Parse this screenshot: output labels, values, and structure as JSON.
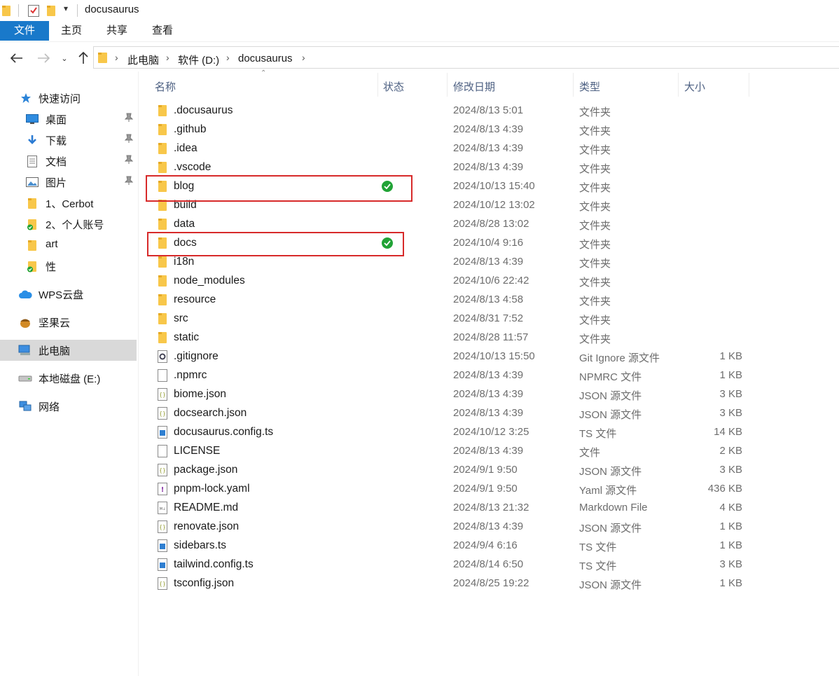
{
  "window": {
    "title": "docusaurus"
  },
  "ribbon": {
    "tabs": [
      "文件",
      "主页",
      "共享",
      "查看"
    ]
  },
  "address": {
    "crumbs": [
      "此电脑",
      "软件 (D:)",
      "docusaurus"
    ]
  },
  "sidebar": {
    "items": [
      {
        "label": "快速访问",
        "icon": "star-icon",
        "pinned": false
      },
      {
        "label": "桌面",
        "icon": "desktop-icon",
        "pinned": true
      },
      {
        "label": "下载",
        "icon": "download-icon",
        "pinned": true
      },
      {
        "label": "文档",
        "icon": "document-icon",
        "pinned": true
      },
      {
        "label": "图片",
        "icon": "picture-icon",
        "pinned": true
      },
      {
        "label": "1、Cerbot",
        "icon": "folder-icon",
        "pinned": false
      },
      {
        "label": "2、个人账号",
        "icon": "folder-sync-icon",
        "pinned": false
      },
      {
        "label": "art",
        "icon": "folder-icon",
        "pinned": false
      },
      {
        "label": "性",
        "icon": "folder-sync-icon",
        "pinned": false
      },
      {
        "label": "WPS云盘",
        "icon": "cloud-icon",
        "pinned": false
      },
      {
        "label": "坚果云",
        "icon": "nut-cloud-icon",
        "pinned": false
      },
      {
        "label": "此电脑",
        "icon": "computer-icon",
        "pinned": false
      },
      {
        "label": "本地磁盘 (E:)",
        "icon": "drive-icon",
        "pinned": false
      },
      {
        "label": "网络",
        "icon": "network-icon",
        "pinned": false
      }
    ]
  },
  "columns": {
    "name": "名称",
    "status": "状态",
    "date": "修改日期",
    "type": "类型",
    "size": "大小"
  },
  "files": [
    {
      "name": ".docusaurus",
      "date": "2024/8/13 5:01",
      "type": "文件夹",
      "size": "",
      "icon": "folder",
      "synced": false
    },
    {
      "name": ".github",
      "date": "2024/8/13 4:39",
      "type": "文件夹",
      "size": "",
      "icon": "folder",
      "synced": false
    },
    {
      "name": ".idea",
      "date": "2024/8/13 4:39",
      "type": "文件夹",
      "size": "",
      "icon": "folder",
      "synced": false
    },
    {
      "name": ".vscode",
      "date": "2024/8/13 4:39",
      "type": "文件夹",
      "size": "",
      "icon": "folder",
      "synced": false
    },
    {
      "name": "blog",
      "date": "2024/10/13 15:40",
      "type": "文件夹",
      "size": "",
      "icon": "folder",
      "synced": true
    },
    {
      "name": "build",
      "date": "2024/10/12 13:02",
      "type": "文件夹",
      "size": "",
      "icon": "folder",
      "synced": false
    },
    {
      "name": "data",
      "date": "2024/8/28 13:02",
      "type": "文件夹",
      "size": "",
      "icon": "folder",
      "synced": false
    },
    {
      "name": "docs",
      "date": "2024/10/4 9:16",
      "type": "文件夹",
      "size": "",
      "icon": "folder",
      "synced": true
    },
    {
      "name": "i18n",
      "date": "2024/8/13 4:39",
      "type": "文件夹",
      "size": "",
      "icon": "folder",
      "synced": false
    },
    {
      "name": "node_modules",
      "date": "2024/10/6 22:42",
      "type": "文件夹",
      "size": "",
      "icon": "folder",
      "synced": false
    },
    {
      "name": "resource",
      "date": "2024/8/13 4:58",
      "type": "文件夹",
      "size": "",
      "icon": "folder",
      "synced": false
    },
    {
      "name": "src",
      "date": "2024/8/31 7:52",
      "type": "文件夹",
      "size": "",
      "icon": "folder",
      "synced": false
    },
    {
      "name": "static",
      "date": "2024/8/28 11:57",
      "type": "文件夹",
      "size": "",
      "icon": "folder",
      "synced": false
    },
    {
      "name": ".gitignore",
      "date": "2024/10/13 15:50",
      "type": "Git Ignore 源文件",
      "size": "1 KB",
      "icon": "gear-file",
      "synced": false
    },
    {
      "name": ".npmrc",
      "date": "2024/8/13 4:39",
      "type": "NPMRC 文件",
      "size": "1 KB",
      "icon": "blank-file",
      "synced": false
    },
    {
      "name": "biome.json",
      "date": "2024/8/13 4:39",
      "type": "JSON 源文件",
      "size": "3 KB",
      "icon": "json-file",
      "synced": false
    },
    {
      "name": "docsearch.json",
      "date": "2024/8/13 4:39",
      "type": "JSON 源文件",
      "size": "3 KB",
      "icon": "json-file",
      "synced": false
    },
    {
      "name": "docusaurus.config.ts",
      "date": "2024/10/12 3:25",
      "type": "TS 文件",
      "size": "14 KB",
      "icon": "ts-file",
      "synced": false
    },
    {
      "name": "LICENSE",
      "date": "2024/8/13 4:39",
      "type": "文件",
      "size": "2 KB",
      "icon": "blank-file",
      "synced": false
    },
    {
      "name": "package.json",
      "date": "2024/9/1 9:50",
      "type": "JSON 源文件",
      "size": "3 KB",
      "icon": "json-file",
      "synced": false
    },
    {
      "name": "pnpm-lock.yaml",
      "date": "2024/9/1 9:50",
      "type": "Yaml 源文件",
      "size": "436 KB",
      "icon": "yaml-file",
      "synced": false
    },
    {
      "name": "README.md",
      "date": "2024/8/13 21:32",
      "type": "Markdown File",
      "size": "4 KB",
      "icon": "md-file",
      "synced": false
    },
    {
      "name": "renovate.json",
      "date": "2024/8/13 4:39",
      "type": "JSON 源文件",
      "size": "1 KB",
      "icon": "json-file",
      "synced": false
    },
    {
      "name": "sidebars.ts",
      "date": "2024/9/4 6:16",
      "type": "TS 文件",
      "size": "1 KB",
      "icon": "ts-file",
      "synced": false
    },
    {
      "name": "tailwind.config.ts",
      "date": "2024/8/14 6:50",
      "type": "TS 文件",
      "size": "3 KB",
      "icon": "ts-file",
      "synced": false
    },
    {
      "name": "tsconfig.json",
      "date": "2024/8/25 19:22",
      "type": "JSON 源文件",
      "size": "1 KB",
      "icon": "json-file",
      "synced": false
    }
  ],
  "colors": {
    "accent": "#1979ca",
    "folder": "#f8c74a",
    "highlight": "#d72a2a",
    "synced": "#21a336"
  }
}
